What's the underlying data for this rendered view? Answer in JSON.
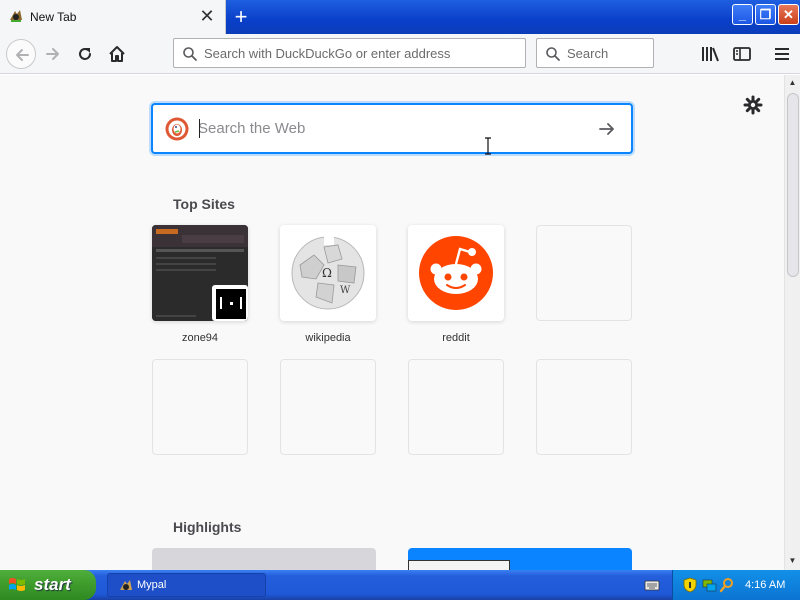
{
  "window": {
    "tab_title": "New Tab",
    "tab_close_glyph": "✕",
    "new_tab_glyph": "+",
    "min_glyph": "_",
    "max_glyph": "❐",
    "close_glyph": "✕"
  },
  "toolbar": {
    "url_placeholder": "Search with DuckDuckGo or enter address",
    "search_placeholder": "Search"
  },
  "newtab": {
    "websearch_placeholder": "Search the Web",
    "topsites_title": "Top Sites",
    "highlights_title": "Highlights",
    "top_sites": [
      {
        "label": "zone94"
      },
      {
        "label": "wikipedia"
      },
      {
        "label": "reddit"
      }
    ]
  },
  "taskbar": {
    "start_label": "start",
    "task_label": "Mypal",
    "clock": "4:16 AM"
  },
  "colors": {
    "focus_blue": "#0a84ff",
    "reddit_orange": "#ff4500",
    "xp_blue": "#245edb",
    "xp_green": "#3d9b2b"
  },
  "icons": [
    "back-icon",
    "forward-icon",
    "reload-icon",
    "home-icon",
    "search-icon",
    "library-icon",
    "sidebar-icon",
    "hamburger-menu-icon",
    "gear-icon",
    "duckduckgo-logo-icon",
    "arrow-right-icon",
    "windows-logo-icon"
  ]
}
